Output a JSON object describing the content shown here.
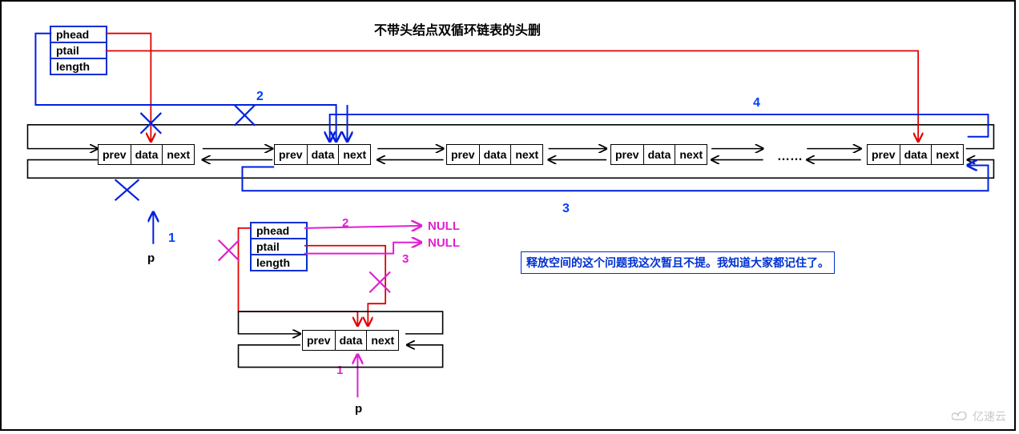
{
  "title": "不带头结点双循环链表的头删",
  "header_top": {
    "row1": "phead",
    "row2": "ptail",
    "row3": "length"
  },
  "header_mid": {
    "row1": "phead",
    "row2": "ptail",
    "row3": "length"
  },
  "node_cells": {
    "prev": "prev",
    "data": "data",
    "next": "next"
  },
  "ellipsis": "……",
  "labels": {
    "top_1": "1",
    "top_2": "2",
    "top_3": "3",
    "top_4": "4",
    "top_p": "p",
    "mid_1": "1",
    "mid_2": "2",
    "mid_3": "3",
    "mid_p": "p",
    "null1": "NULL",
    "null2": "NULL"
  },
  "note": "释放空间的这个问题我这次暂且不提。我知道大家都记住了。",
  "watermark": "亿速云",
  "chart_data": {
    "type": "diagram",
    "description": "Head-deletion on a doubly-linked circular list without a dummy head node",
    "list_header_fields": [
      "phead",
      "ptail",
      "length"
    ],
    "node_fields": [
      "prev",
      "data",
      "next"
    ],
    "main_list_nodes": 5,
    "main_list_circular": true,
    "step_labels_main": [
      "1 (p = phead)",
      "2 (phead = phead->next)",
      "3 (phead->prev = ptail)",
      "4 (ptail->next = phead)"
    ],
    "special_case": {
      "description": "single-node list becomes empty; phead and ptail both become NULL",
      "step_labels": [
        "1 (p = node)",
        "2 (phead = NULL)",
        "3 (ptail = NULL)"
      ]
    },
    "annotation": "释放空间的这个问题我这次暂且不提。我知道大家都记住了。",
    "deleted_links_marked_with_X": true
  }
}
